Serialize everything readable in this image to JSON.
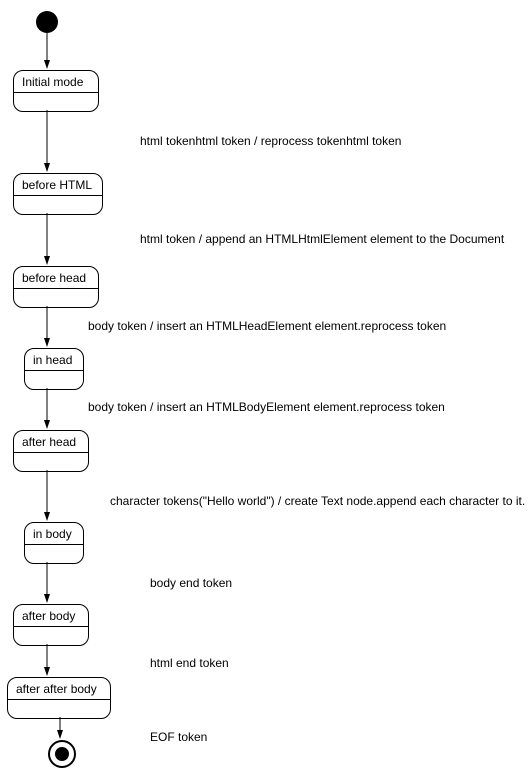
{
  "chart_data": {
    "type": "uml-state-diagram",
    "title": "",
    "initial": true,
    "final": true,
    "states": [
      {
        "id": "s0",
        "label": "Initial mode"
      },
      {
        "id": "s1",
        "label": "before HTML"
      },
      {
        "id": "s2",
        "label": "before head"
      },
      {
        "id": "s3",
        "label": "in head"
      },
      {
        "id": "s4",
        "label": "after head"
      },
      {
        "id": "s5",
        "label": "in body"
      },
      {
        "id": "s6",
        "label": "after body"
      },
      {
        "id": "s7",
        "label": "after after body"
      }
    ],
    "transitions": [
      {
        "from": "initial",
        "to": "s0",
        "label": ""
      },
      {
        "from": "s0",
        "to": "s1",
        "label": "html tokenhtml token / reprocess tokenhtml token"
      },
      {
        "from": "s1",
        "to": "s2",
        "label": "html token / append an HTMLHtmlElement element to the Document"
      },
      {
        "from": "s2",
        "to": "s3",
        "label": "body token / insert an HTMLHeadElement element.reprocess token"
      },
      {
        "from": "s3",
        "to": "s4",
        "label": "body token / insert an HTMLBodyElement element.reprocess token"
      },
      {
        "from": "s4",
        "to": "s5",
        "label": "character tokens(\"Hello world\") / create Text node.append each character to it."
      },
      {
        "from": "s5",
        "to": "s6",
        "label": "body end token"
      },
      {
        "from": "s6",
        "to": "s7",
        "label": "html end token"
      },
      {
        "from": "s7",
        "to": "final",
        "label": "EOF token"
      }
    ]
  },
  "states": {
    "s0": "Initial mode",
    "s1": "before HTML",
    "s2": "before head",
    "s3": "in head",
    "s4": "after head",
    "s5": "in body",
    "s6": "after body",
    "s7": "after after body"
  },
  "labels": {
    "t1": "html tokenhtml token / reprocess tokenhtml token",
    "t2": "html token / append an HTMLHtmlElement element to the Document",
    "t3": "body token / insert an HTMLHeadElement element.reprocess token",
    "t4": "body token / insert an HTMLBodyElement element.reprocess token",
    "t5": "character tokens(\"Hello world\") / create Text node.append each character to it.",
    "t6": "body end token",
    "t7": "html end token",
    "t8": "EOF token"
  }
}
